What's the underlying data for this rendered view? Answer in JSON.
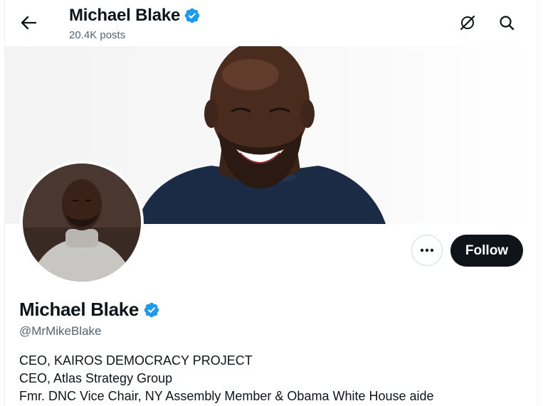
{
  "header": {
    "name": "Michael Blake",
    "posts": "20.4K posts",
    "verified": true
  },
  "profile": {
    "name": "Michael Blake",
    "handle": "@MrMikeBlake",
    "bio_lines": [
      "CEO, KAIROS DEMOCRACY PROJECT",
      "CEO, Atlas Strategy Group",
      "Fmr. DNC Vice Chair, NY Assembly Member & Obama White House aide"
    ]
  },
  "actions": {
    "follow_label": "Follow"
  },
  "icons": {
    "back": "arrow-left-icon",
    "grok": "grok-icon",
    "search": "search-icon",
    "more": "more-dots-icon",
    "verified": "verified-badge-icon"
  },
  "colors": {
    "verified": "#1d9bf0",
    "follow_bg": "#0f1419",
    "secondary_text": "#536471"
  }
}
